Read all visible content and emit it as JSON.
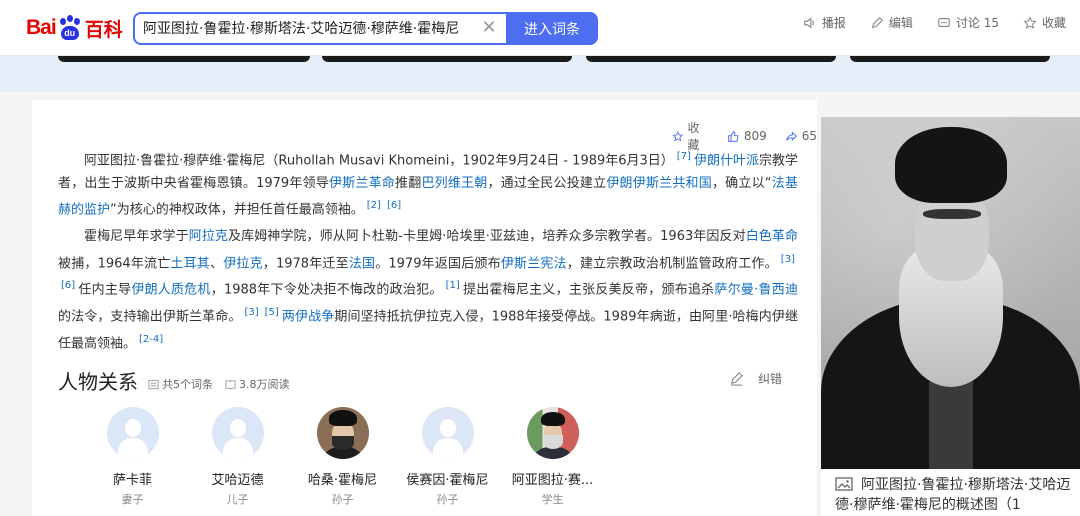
{
  "header": {
    "logo_bai": "Bai",
    "logo_du": "du",
    "logo_baike": "百科",
    "search_value": "阿亚图拉·鲁霍拉·穆斯塔法·艾哈迈德·穆萨维·霍梅尼",
    "search_button": "进入词条",
    "actions": {
      "play": "播报",
      "edit": "编辑",
      "discuss": "讨论 15",
      "favorite": "收藏"
    }
  },
  "meta": {
    "favorite": "收藏",
    "likes": "809",
    "shares": "65"
  },
  "para1": {
    "t1": "阿亚图拉·鲁霍拉·穆萨维·霍梅尼（Ruhollah Musavi Khomeini，1902年9月24日 - 1989年6月3日）",
    "ref1": "[7]",
    "link1": "伊朗什叶派",
    "t2": "宗教学者，出生于波斯中央省霍梅恩镇。1979年领导",
    "link2": "伊斯兰革命",
    "t3": "推翻",
    "link3": "巴列维王朝",
    "t4": "，通过全民公投建立",
    "link4": "伊朗伊斯兰共和国",
    "t5": "，确立以“",
    "link5": "法基赫的监护",
    "t6": "”为核心的神权政体，并担任首任最高领袖。",
    "ref2": "[2]",
    "ref3": "[6]"
  },
  "para2": {
    "t1": "霍梅尼早年求学于",
    "link1": "阿拉克",
    "t2": "及库姆神学院，师从阿卜杜勒-卡里姆·哈埃里·亚兹迪，培养众多宗教学者。1963年因反对",
    "link2": "白色革命",
    "t3": "被捕，1964年流亡",
    "link3": "土耳其",
    "t4": "、",
    "link4": "伊拉克",
    "t5": "，1978年迁至",
    "link5": "法国",
    "t6": "。1979年返国后颁布",
    "link6": "伊斯兰宪法",
    "t7": "，建立宗教政治机制监管政府工作。",
    "ref1": "[3]",
    "ref2": "[6]",
    "t8": "任内主导",
    "link7": "伊朗人质危机",
    "t9": "，1988年下令处决拒不悔改的政治犯。",
    "ref3": "[1]",
    "t10": "提出霍梅尼主义，主张反美反帝，颁布追杀",
    "link8": "萨尔曼·鲁西迪",
    "t11": "的法令，支持输出伊斯兰革命。",
    "ref4": "[3]",
    "ref5": "[5]",
    "link9": "两伊战争",
    "t12": "期间坚持抵抗伊拉克入侵，1988年接受停战。1989年病逝，由阿里·哈梅内伊继任最高领袖。",
    "ref6": "[2-4]"
  },
  "relations": {
    "title": "人物关系",
    "count": "共5个词条",
    "reads": "3.8万阅读",
    "correct": "纠错",
    "people": [
      {
        "name": "萨卡菲",
        "rel": "妻子"
      },
      {
        "name": "艾哈迈德",
        "rel": "儿子"
      },
      {
        "name": "哈桑·霍梅尼",
        "rel": "孙子"
      },
      {
        "name": "侯赛因·霍梅尼",
        "rel": "孙子"
      },
      {
        "name": "阿亚图拉·赛...",
        "rel": "学生"
      }
    ]
  },
  "portrait": {
    "caption": "阿亚图拉·鲁霍拉·穆斯塔法·艾哈迈德·穆萨维·霍梅尼的概述图（1"
  }
}
